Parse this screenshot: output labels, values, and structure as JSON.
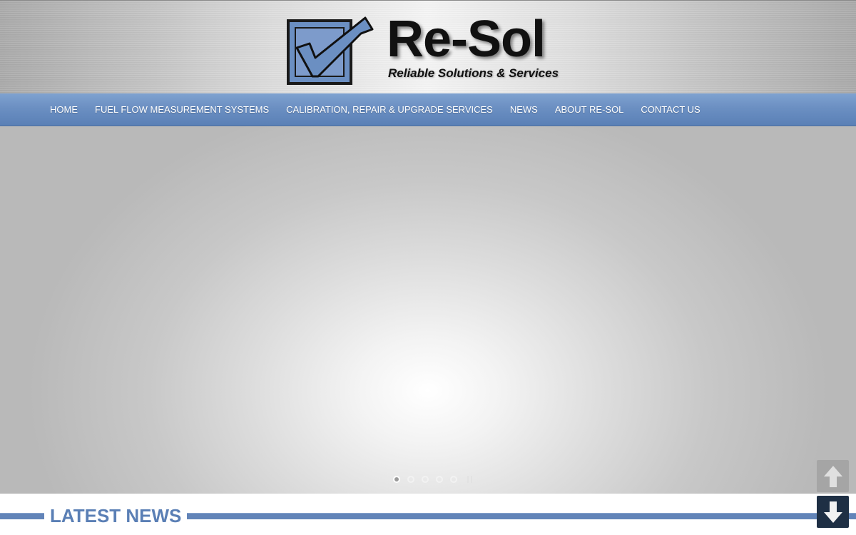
{
  "brand": {
    "name": "Re-Sol",
    "tagline": "Reliable Solutions & Services"
  },
  "nav": {
    "items": [
      {
        "label": "HOME"
      },
      {
        "label": "FUEL FLOW MEASUREMENT SYSTEMS"
      },
      {
        "label": "CALIBRATION, REPAIR & UPGRADE SERVICES"
      },
      {
        "label": "NEWS"
      },
      {
        "label": "ABOUT RE-SOL"
      },
      {
        "label": "CONTACT US"
      }
    ]
  },
  "slider": {
    "next_glyph": "›",
    "slide_count": 5,
    "active_slide": 1
  },
  "news": {
    "heading": "LATEST NEWS"
  },
  "colors": {
    "nav_blue": "#6b8fc2",
    "heading_blue": "#5a7fb5",
    "logo_blue": "#6b8fc2",
    "scroll_up_bg": "#a5a5a5",
    "scroll_down_bg": "#1e2f44"
  },
  "icons": {
    "scroll_up": "arrow-up-icon",
    "scroll_down": "arrow-down-icon",
    "slider_next": "chevron-right-icon",
    "slider_pause": "pause-icon"
  }
}
